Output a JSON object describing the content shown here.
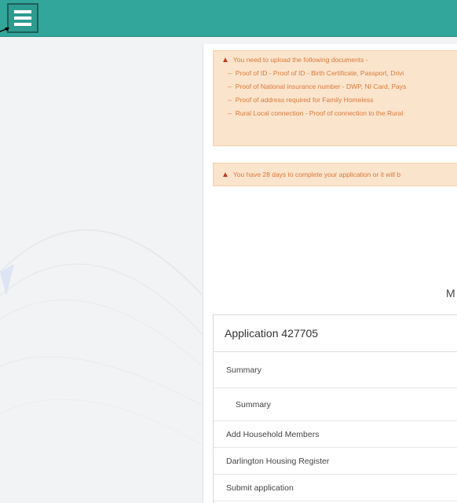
{
  "alerts": {
    "documents": {
      "heading": "You need to upload the following documents -",
      "items": [
        "Proof of ID - Proof of ID - Birth Certificate, Passport, Drivi",
        "Proof of National insurance number - DWP, NI Card, Pays",
        "Proof of address required for Family Homeless",
        "Rural Local connection - Proof of connection to the Rural"
      ]
    },
    "deadline": "You have 28 days to complete your application or it will b"
  },
  "main": {
    "heading_partial": "M"
  },
  "application": {
    "title": "Application 427705",
    "summary_header": "Summary",
    "summary_sub": "Summary",
    "steps": [
      "Add Household Members",
      "Darlington Housing Register",
      "Submit application"
    ]
  },
  "colors": {
    "topbar": "#32a69a",
    "alert_bg": "#fbe4cc",
    "alert_text": "#d8793a",
    "warning_icon": "#c23a23"
  }
}
